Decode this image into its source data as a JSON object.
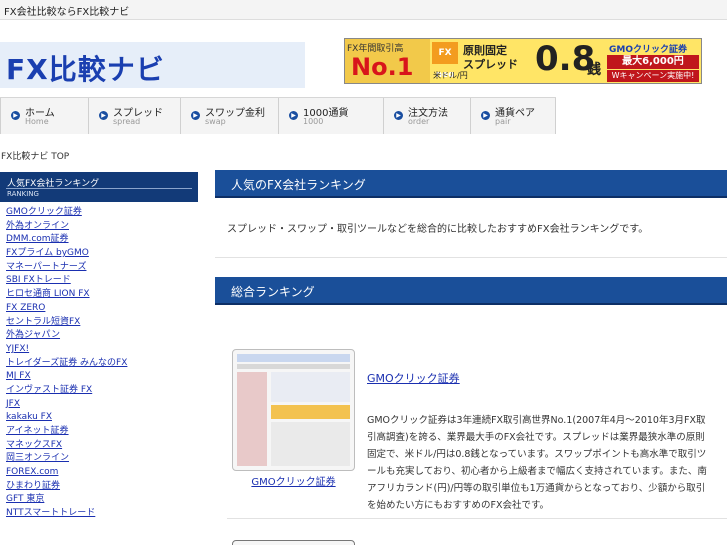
{
  "topbar": {
    "text": "FX会社比較ならFX比較ナビ"
  },
  "header": {
    "logo_text": "FX比較ナビ",
    "banner": {
      "rank_label": "FX年間取引高",
      "rank_value": "No.1",
      "fx_badge": "FX neo",
      "line1": "原則固定",
      "line2": "スプレッド",
      "line3": "米ドル/円",
      "big_value": "0.8",
      "unit": "銭",
      "brand": "GMOクリック証券",
      "max_offer": "最大6,000円",
      "campaign": "Wキャンペーン実施中!"
    }
  },
  "nav": {
    "items": [
      {
        "label": "ホーム",
        "sub": "Home"
      },
      {
        "label": "スプレッド",
        "sub": "spread"
      },
      {
        "label": "スワップ金利",
        "sub": "swap"
      },
      {
        "label": "1000通貨",
        "sub": "1000"
      },
      {
        "label": "注文方法",
        "sub": "order"
      },
      {
        "label": "通貨ペア",
        "sub": "pair"
      }
    ]
  },
  "breadcrumb": "FX比較ナビ TOP",
  "sidebar": {
    "heading": "人気FX会社ランキング",
    "heading_sub": "RANKING",
    "items": [
      "GMOクリック証券",
      "外為オンライン",
      "DMM.com証券",
      "FXプライム byGMO",
      "マネーパートナーズ",
      "SBI FXトレード",
      "ヒロセ通商 LION FX",
      "FX ZERO",
      "セントラル短資FX",
      "外為ジャパン",
      "YJFX!",
      "トレイダーズ証券 みんなのFX",
      "MJ FX",
      "インヴァスト証券 FX",
      "JFX",
      "kakaku FX",
      "アイネット証券",
      "マネックスFX",
      "岡三オンライン",
      "FOREX.com",
      "ひまわり証券",
      "GFT 東京",
      "NTTスマートトレード"
    ]
  },
  "main": {
    "section1_title": "人気のFX会社ランキング",
    "intro": "スプレッド・スワップ・取引ツールなどを総合的に比較したおすすめFX会社ランキングです。",
    "section2_title": "総合ランキング",
    "company": {
      "title": "GMOクリック証券",
      "thumb_caption": "GMOクリック証券",
      "description": "GMOクリック証券は3年連続FX取引高世界No.1(2007年4月〜2010年3月FX取引高調査)を誇る、業界最大手のFX会社です。スプレッドは業界最狭水準の原則固定で、米ドル/円は0.8銭となっています。スワップポイントも高水準で取引ツールも充実しており、初心者から上級者まで幅広く支持されています。また、南アフリカランド(円)/円等の取引単位も1万通貨からとなっており、少額から取引を始めたい方にもおすすめのFX会社です。"
    }
  }
}
